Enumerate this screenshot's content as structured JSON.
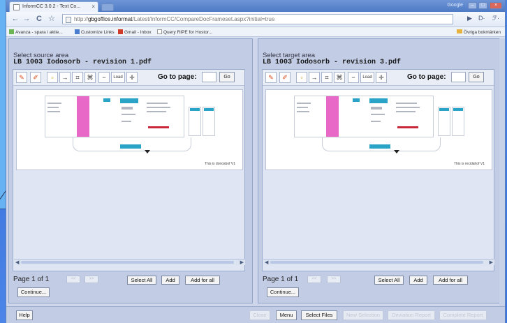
{
  "browser": {
    "tab_title": "InformCC 3.0.2 - Text Co...",
    "tab_close": "×",
    "user_label": "Google",
    "url_prefix": "http://",
    "url_host": "gbgoffice.informat",
    "url_rest": "/Latest/InformCC/CompareDocFrameset.aspx?initial=true",
    "back_icon": "←",
    "forward_icon": "→",
    "reload_icon": "C",
    "star_icon": "☆",
    "page_menu": "▶",
    "doc_menu": "D·",
    "tools_menu": "ℱ·"
  },
  "bookmarks": {
    "items": [
      {
        "label": "Avanza - spara i aktie..."
      },
      {
        "label": "Customize Links"
      },
      {
        "label": "Gmail - Inbox"
      },
      {
        "label": "Query RIPE for Hostor..."
      }
    ],
    "other": "Övriga bokmärken"
  },
  "source": {
    "area_label": "Select source area",
    "doc_title": "LB 1003 Iodosorb - revision 1.pdf",
    "caption": "This is donosbof V1"
  },
  "target": {
    "area_label": "Select target area",
    "doc_title": "LB 1003 Iodosorb - revision 3.pdf",
    "caption": "This is recidahof V1"
  },
  "viewer": {
    "load_label": "Load",
    "goto_label": "Go to page:",
    "go_label": "Go",
    "page_text": "Page 1 of 1",
    "prev_label": "<<",
    "next_label": ">>",
    "select_all": "Select All",
    "add": "Add",
    "add_for_all": "Add for all",
    "continue": "Continue..."
  },
  "bottom": {
    "help": "Help",
    "close": "Close",
    "menu": "Menu",
    "select_files": "Select Files",
    "new_selection": "New Selection",
    "deviation_report": "Deviation Report",
    "complete_report": "Complete Report"
  },
  "colors": {
    "pink": "#e868c8",
    "teal": "#2aa4c6",
    "red": "#c8283a"
  }
}
